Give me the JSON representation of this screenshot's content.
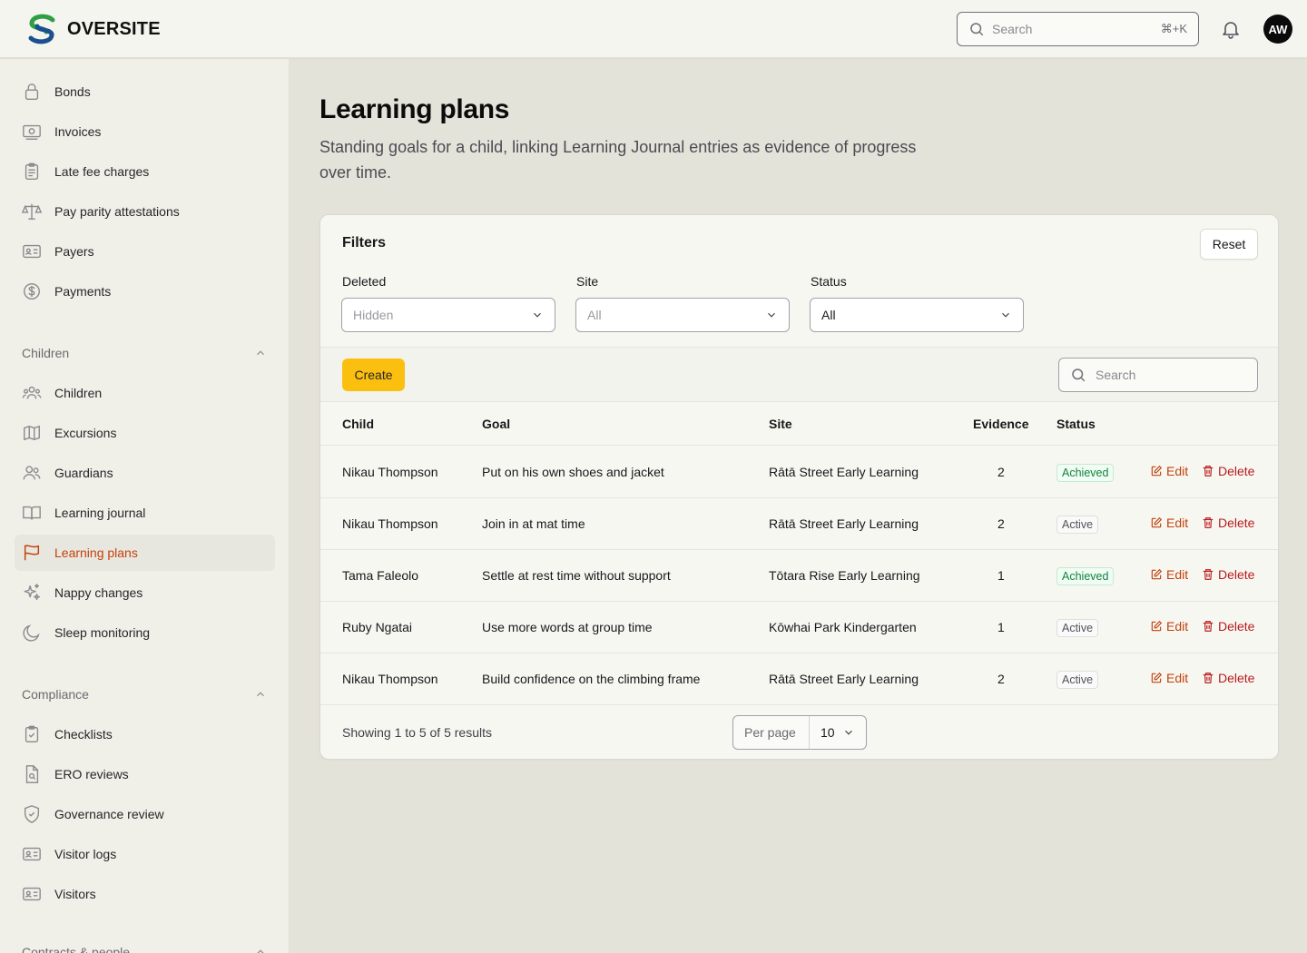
{
  "brand": {
    "name": "OVERSITE"
  },
  "header": {
    "search_placeholder": "Search",
    "shortcut": "⌘+K",
    "avatar_initials": "AW"
  },
  "sidebar": {
    "top_items": [
      {
        "label": "Bonds",
        "icon": "lock-icon"
      },
      {
        "label": "Invoices",
        "icon": "banknote-icon"
      },
      {
        "label": "Late fee charges",
        "icon": "clipboard-list-icon"
      },
      {
        "label": "Pay parity attestations",
        "icon": "scale-icon"
      },
      {
        "label": "Payers",
        "icon": "id-card-icon"
      },
      {
        "label": "Payments",
        "icon": "dollar-circle-icon"
      }
    ],
    "children_section": "Children",
    "children_items": [
      {
        "label": "Children",
        "icon": "users-group-icon"
      },
      {
        "label": "Excursions",
        "icon": "map-icon"
      },
      {
        "label": "Guardians",
        "icon": "users-icon"
      },
      {
        "label": "Learning journal",
        "icon": "book-open-icon"
      },
      {
        "label": "Learning plans",
        "icon": "flag-icon",
        "active": true
      },
      {
        "label": "Nappy changes",
        "icon": "sparkles-icon"
      },
      {
        "label": "Sleep monitoring",
        "icon": "moon-icon"
      }
    ],
    "compliance_section": "Compliance",
    "compliance_items": [
      {
        "label": "Checklists",
        "icon": "clipboard-check-icon"
      },
      {
        "label": "ERO reviews",
        "icon": "file-search-icon"
      },
      {
        "label": "Governance review",
        "icon": "shield-icon"
      },
      {
        "label": "Visitor logs",
        "icon": "id-card-icon"
      },
      {
        "label": "Visitors",
        "icon": "id-card-icon"
      }
    ],
    "next_section_partial": "Contracts & people"
  },
  "page": {
    "title": "Learning plans",
    "description": "Standing goals for a child, linking Learning Journal entries as evidence of progress over time."
  },
  "filters": {
    "title": "Filters",
    "reset_label": "Reset",
    "deleted": {
      "label": "Deleted",
      "value": "Hidden"
    },
    "site": {
      "label": "Site",
      "value": "All"
    },
    "status": {
      "label": "Status",
      "value": "All"
    }
  },
  "toolbar": {
    "create_label": "Create",
    "search_placeholder": "Search"
  },
  "table": {
    "columns": [
      "Child",
      "Goal",
      "Site",
      "Evidence",
      "Status"
    ],
    "rows": [
      {
        "child": "Nikau Thompson",
        "goal": "Put on his own shoes and jacket",
        "site": "Rātā Street Early Learning",
        "evidence": "2",
        "status": "Achieved"
      },
      {
        "child": "Nikau Thompson",
        "goal": "Join in at mat time",
        "site": "Rātā Street Early Learning",
        "evidence": "2",
        "status": "Active"
      },
      {
        "child": "Tama Faleolo",
        "goal": "Settle at rest time without support",
        "site": "Tōtara Rise Early Learning",
        "evidence": "1",
        "status": "Achieved"
      },
      {
        "child": "Ruby Ngatai",
        "goal": "Use more words at group time",
        "site": "Kōwhai Park Kindergarten",
        "evidence": "1",
        "status": "Active"
      },
      {
        "child": "Nikau Thompson",
        "goal": "Build confidence on the climbing frame",
        "site": "Rātā Street Early Learning",
        "evidence": "2",
        "status": "Active"
      }
    ],
    "edit_label": "Edit",
    "delete_label": "Delete"
  },
  "pagination": {
    "summary": "Showing 1 to 5 of 5 results",
    "per_page_label": "Per page",
    "per_page_value": "10"
  },
  "colors": {
    "accent": "#c2410c",
    "danger": "#b91c1c",
    "create": "#fbbf0f",
    "achieved": "#15803d"
  }
}
